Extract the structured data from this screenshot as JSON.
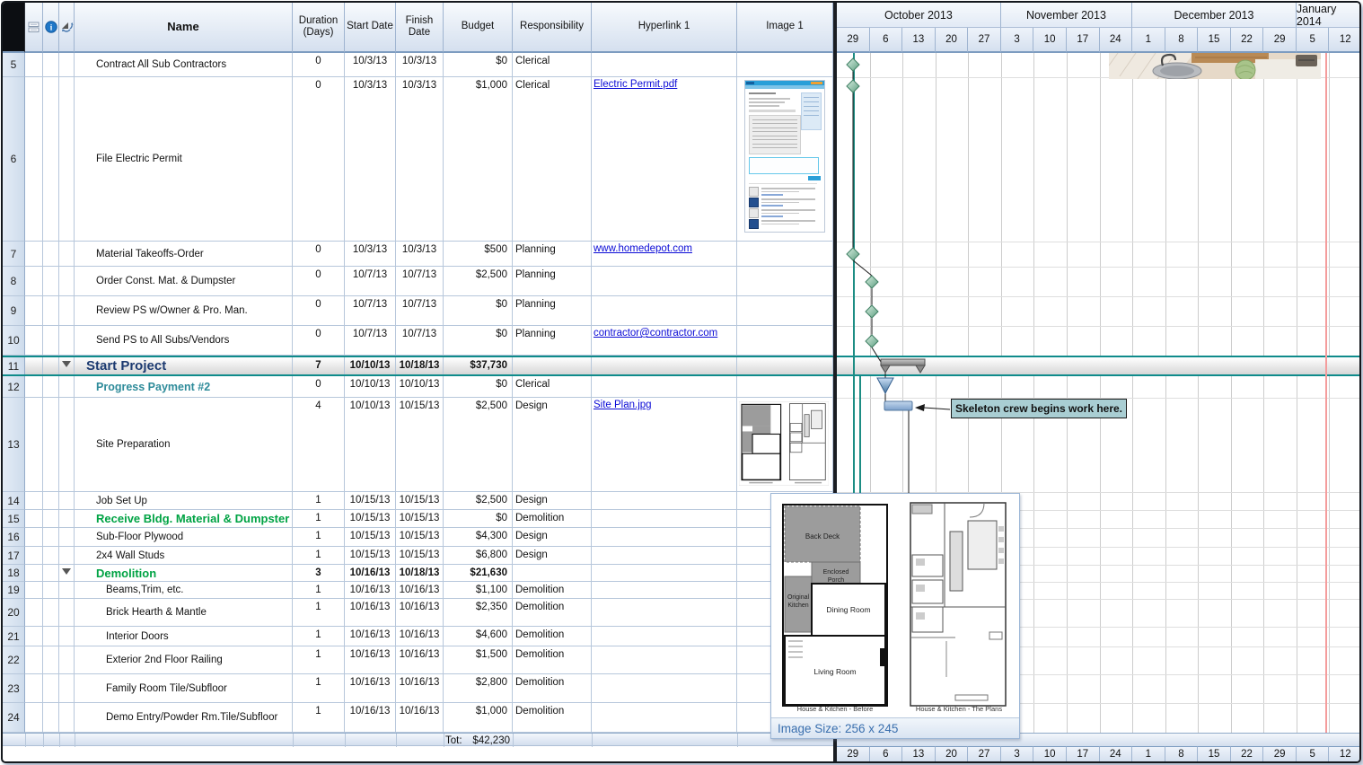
{
  "header_icons": {
    "notes": "stacked-notes",
    "info": "info-circle",
    "links": "link-arrows"
  },
  "columns": [
    {
      "label": "Name"
    },
    {
      "label": "Duration (Days)"
    },
    {
      "label": "Start Date"
    },
    {
      "label": "Finish Date"
    },
    {
      "label": "Budget"
    },
    {
      "label": "Responsibility"
    },
    {
      "label": "Hyperlink 1"
    },
    {
      "label": "Image 1"
    }
  ],
  "rows": [
    {
      "num": "5",
      "name": "Contract All Sub Contractors",
      "duration": "0",
      "start": "10/3/13",
      "finish": "10/3/13",
      "budget": "$0",
      "resp": "Clerical",
      "link": "",
      "img": "",
      "style": "plain",
      "indent": 1
    },
    {
      "num": "6",
      "name": "File Electric Permit",
      "duration": "0",
      "start": "10/3/13",
      "finish": "10/3/13",
      "budget": "$1,000",
      "resp": "Clerical",
      "link": "Electric Permit.pdf",
      "img": "permit",
      "style": "plain",
      "indent": 1
    },
    {
      "num": "7",
      "name": "Material Takeoffs-Order",
      "duration": "0",
      "start": "10/3/13",
      "finish": "10/3/13",
      "budget": "$500",
      "resp": "Planning",
      "link": "www.homedepot.com",
      "img": "",
      "style": "plain",
      "indent": 1
    },
    {
      "num": "8",
      "name": "Order Const. Mat. & Dumpster",
      "duration": "0",
      "start": "10/7/13",
      "finish": "10/7/13",
      "budget": "$2,500",
      "resp": "Planning",
      "link": "",
      "img": "",
      "style": "plain",
      "indent": 1
    },
    {
      "num": "9",
      "name": "Review PS w/Owner & Pro. Man.",
      "duration": "0",
      "start": "10/7/13",
      "finish": "10/7/13",
      "budget": "$0",
      "resp": "Planning",
      "link": "",
      "img": "",
      "style": "plain",
      "indent": 1
    },
    {
      "num": "10",
      "name": "Send PS to All Subs/Vendors",
      "duration": "0",
      "start": "10/7/13",
      "finish": "10/7/13",
      "budget": "$0",
      "resp": "Planning",
      "link": "contractor@contractor.com",
      "img": "",
      "style": "plain",
      "indent": 1
    },
    {
      "num": "11",
      "name": "Start Project",
      "duration": "7",
      "start": "10/10/13",
      "finish": "10/18/13",
      "budget": "$37,730",
      "resp": "",
      "link": "",
      "img": "",
      "style": "summary",
      "indent": 0
    },
    {
      "num": "12",
      "name": "Progress Payment #2",
      "duration": "0",
      "start": "10/10/13",
      "finish": "10/10/13",
      "budget": "$0",
      "resp": "Clerical",
      "link": "",
      "img": "",
      "style": "teal",
      "indent": 1
    },
    {
      "num": "13",
      "name": "Site Preparation",
      "duration": "4",
      "start": "10/10/13",
      "finish": "10/15/13",
      "budget": "$2,500",
      "resp": "Design",
      "link": "Site Plan.jpg",
      "img": "siteplan",
      "style": "plain",
      "indent": 1
    },
    {
      "num": "14",
      "name": "Job Set Up",
      "duration": "1",
      "start": "10/15/13",
      "finish": "10/15/13",
      "budget": "$2,500",
      "resp": "Design",
      "link": "",
      "img": "",
      "style": "plain",
      "indent": 1
    },
    {
      "num": "15",
      "name": "Receive Bldg. Material & Dumpster",
      "duration": "1",
      "start": "10/15/13",
      "finish": "10/15/13",
      "budget": "$0",
      "resp": "Demolition",
      "link": "",
      "img": "",
      "style": "green",
      "indent": 1
    },
    {
      "num": "16",
      "name": "Sub-Floor Plywood",
      "duration": "1",
      "start": "10/15/13",
      "finish": "10/15/13",
      "budget": "$4,300",
      "resp": "Design",
      "link": "",
      "img": "",
      "style": "plain",
      "indent": 1
    },
    {
      "num": "17",
      "name": "2x4 Wall Studs",
      "duration": "1",
      "start": "10/15/13",
      "finish": "10/15/13",
      "budget": "$6,800",
      "resp": "Design",
      "link": "",
      "img": "",
      "style": "plain",
      "indent": 1
    },
    {
      "num": "18",
      "name": "Demolition",
      "duration": "3",
      "start": "10/16/13",
      "finish": "10/18/13",
      "budget": "$21,630",
      "resp": "",
      "link": "",
      "img": "",
      "style": "gsummary",
      "indent": 1
    },
    {
      "num": "19",
      "name": "Beams,Trim, etc.",
      "duration": "1",
      "start": "10/16/13",
      "finish": "10/16/13",
      "budget": "$1,100",
      "resp": "Demolition",
      "link": "",
      "img": "",
      "style": "plain",
      "indent": 2
    },
    {
      "num": "20",
      "name": "Brick Hearth & Mantle",
      "duration": "1",
      "start": "10/16/13",
      "finish": "10/16/13",
      "budget": "$2,350",
      "resp": "Demolition",
      "link": "",
      "img": "",
      "style": "plain",
      "indent": 2
    },
    {
      "num": "21",
      "name": "Interior Doors",
      "duration": "1",
      "start": "10/16/13",
      "finish": "10/16/13",
      "budget": "$4,600",
      "resp": "Demolition",
      "link": "",
      "img": "",
      "style": "plain",
      "indent": 2
    },
    {
      "num": "22",
      "name": "Exterior 2nd Floor Railing",
      "duration": "1",
      "start": "10/16/13",
      "finish": "10/16/13",
      "budget": "$1,500",
      "resp": "Demolition",
      "link": "",
      "img": "",
      "style": "plain",
      "indent": 2
    },
    {
      "num": "23",
      "name": "Family Room Tile/Subfloor",
      "duration": "1",
      "start": "10/16/13",
      "finish": "10/16/13",
      "budget": "$2,800",
      "resp": "Demolition",
      "link": "",
      "img": "",
      "style": "plain",
      "indent": 2
    },
    {
      "num": "24",
      "name": "Demo Entry/Powder Rm.Tile/Subfloor",
      "duration": "1",
      "start": "10/16/13",
      "finish": "10/16/13",
      "budget": "$1,000",
      "resp": "Demolition",
      "link": "",
      "img": "",
      "style": "plain",
      "indent": 2
    }
  ],
  "footer": {
    "total_label": "Tot:",
    "total_value": "$42,230"
  },
  "timeline": {
    "months": [
      {
        "label": "October 2013",
        "weeks": [
          "29",
          "6",
          "13",
          "20",
          "27"
        ]
      },
      {
        "label": "November 2013",
        "weeks": [
          "3",
          "10",
          "17",
          "24"
        ]
      },
      {
        "label": "December 2013",
        "weeks": [
          "1",
          "8",
          "15",
          "22",
          "29"
        ]
      },
      {
        "label": "January 2014",
        "weeks": [
          "5",
          "12"
        ]
      }
    ],
    "footer_weeks": [
      "29",
      "6",
      "13",
      "20",
      "27",
      "3",
      "10",
      "17",
      "24",
      "1",
      "8",
      "15",
      "22",
      "29",
      "5",
      "12"
    ]
  },
  "gantt": {
    "callout": "Skeleton crew begins work here.",
    "items": [
      {
        "row": "5",
        "type": "milestone",
        "date": "10/3/13"
      },
      {
        "row": "6",
        "type": "milestone",
        "date": "10/3/13"
      },
      {
        "row": "7",
        "type": "milestone",
        "date": "10/3/13"
      },
      {
        "row": "8",
        "type": "milestone",
        "date": "10/7/13"
      },
      {
        "row": "9",
        "type": "milestone",
        "date": "10/7/13"
      },
      {
        "row": "10",
        "type": "milestone",
        "date": "10/7/13"
      },
      {
        "row": "11",
        "type": "summary-bar",
        "start": "10/10/13",
        "finish": "10/18/13"
      },
      {
        "row": "12",
        "type": "milestone-triangle",
        "date": "10/10/13"
      },
      {
        "row": "13",
        "type": "task-bar",
        "start": "10/10/13",
        "finish": "10/15/13"
      }
    ]
  },
  "popup": {
    "status": "Image Size: 256 x 245",
    "captions": [
      "House & Kitchen - Before",
      "House & Kitchen - The Plans"
    ],
    "room_labels": [
      "Back Deck",
      "Enclosed",
      "Porch",
      "Original",
      "Kitchen",
      "Dining Room",
      "Living Room"
    ]
  },
  "colors": {
    "accent_teal": "#0f8b8b",
    "summary_navy": "#1c3a70",
    "teal_task_text": "#2e8b9a",
    "green_task_text": "#00a344",
    "hyperlink": "#0b0bd6",
    "milestone_green": "#6fae8f",
    "task_bar_blue": "#8fb0d8",
    "callout_bg": "#a9ced3",
    "pink_marker_line": "#f49d9d",
    "teal_marker_line": "#1d8d84"
  }
}
